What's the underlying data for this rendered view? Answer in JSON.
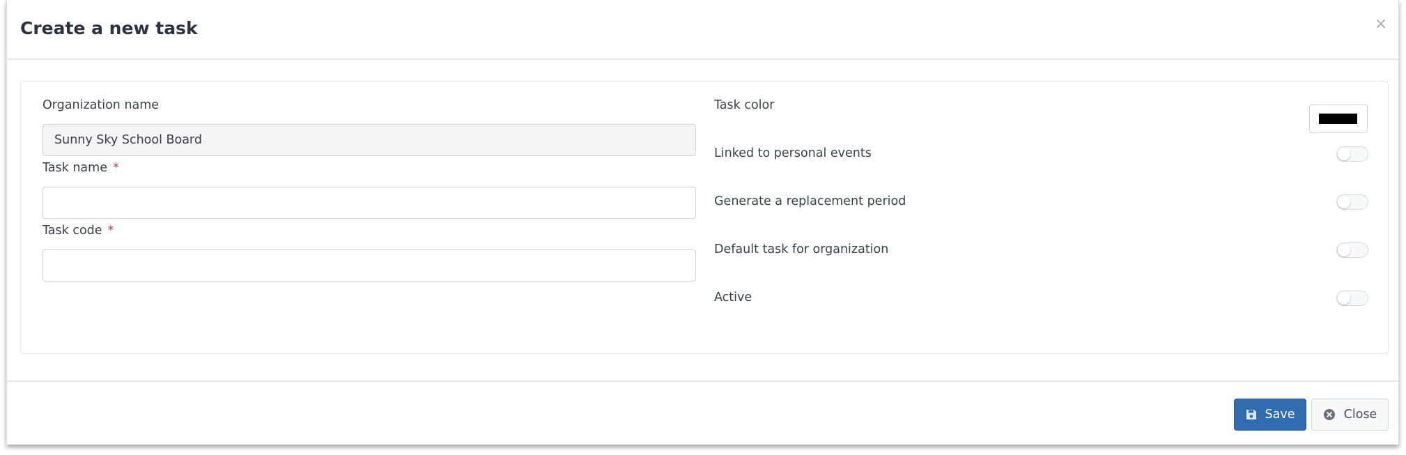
{
  "modal": {
    "title": "Create a new task",
    "close_glyph": "×"
  },
  "form": {
    "organization": {
      "label": "Organization name",
      "value": "Sunny Sky School Board"
    },
    "task_name": {
      "label": "Task name",
      "required_mark": "*",
      "value": ""
    },
    "task_code": {
      "label": "Task code",
      "required_mark": "*",
      "value": ""
    },
    "task_color": {
      "label": "Task color",
      "value": "#000000"
    },
    "toggles": [
      {
        "label": "Linked to personal events",
        "on": false
      },
      {
        "label": "Generate a replacement period",
        "on": false
      },
      {
        "label": "Default task for organization",
        "on": false
      },
      {
        "label": "Active",
        "on": false
      }
    ]
  },
  "footer": {
    "save_label": "Save",
    "close_label": "Close"
  },
  "icons": {
    "save": "floppy-disk-icon",
    "close": "circle-x-icon",
    "header_close": "close-icon"
  },
  "colors": {
    "primary": "#2f6cb0",
    "required": "#c0395b"
  }
}
